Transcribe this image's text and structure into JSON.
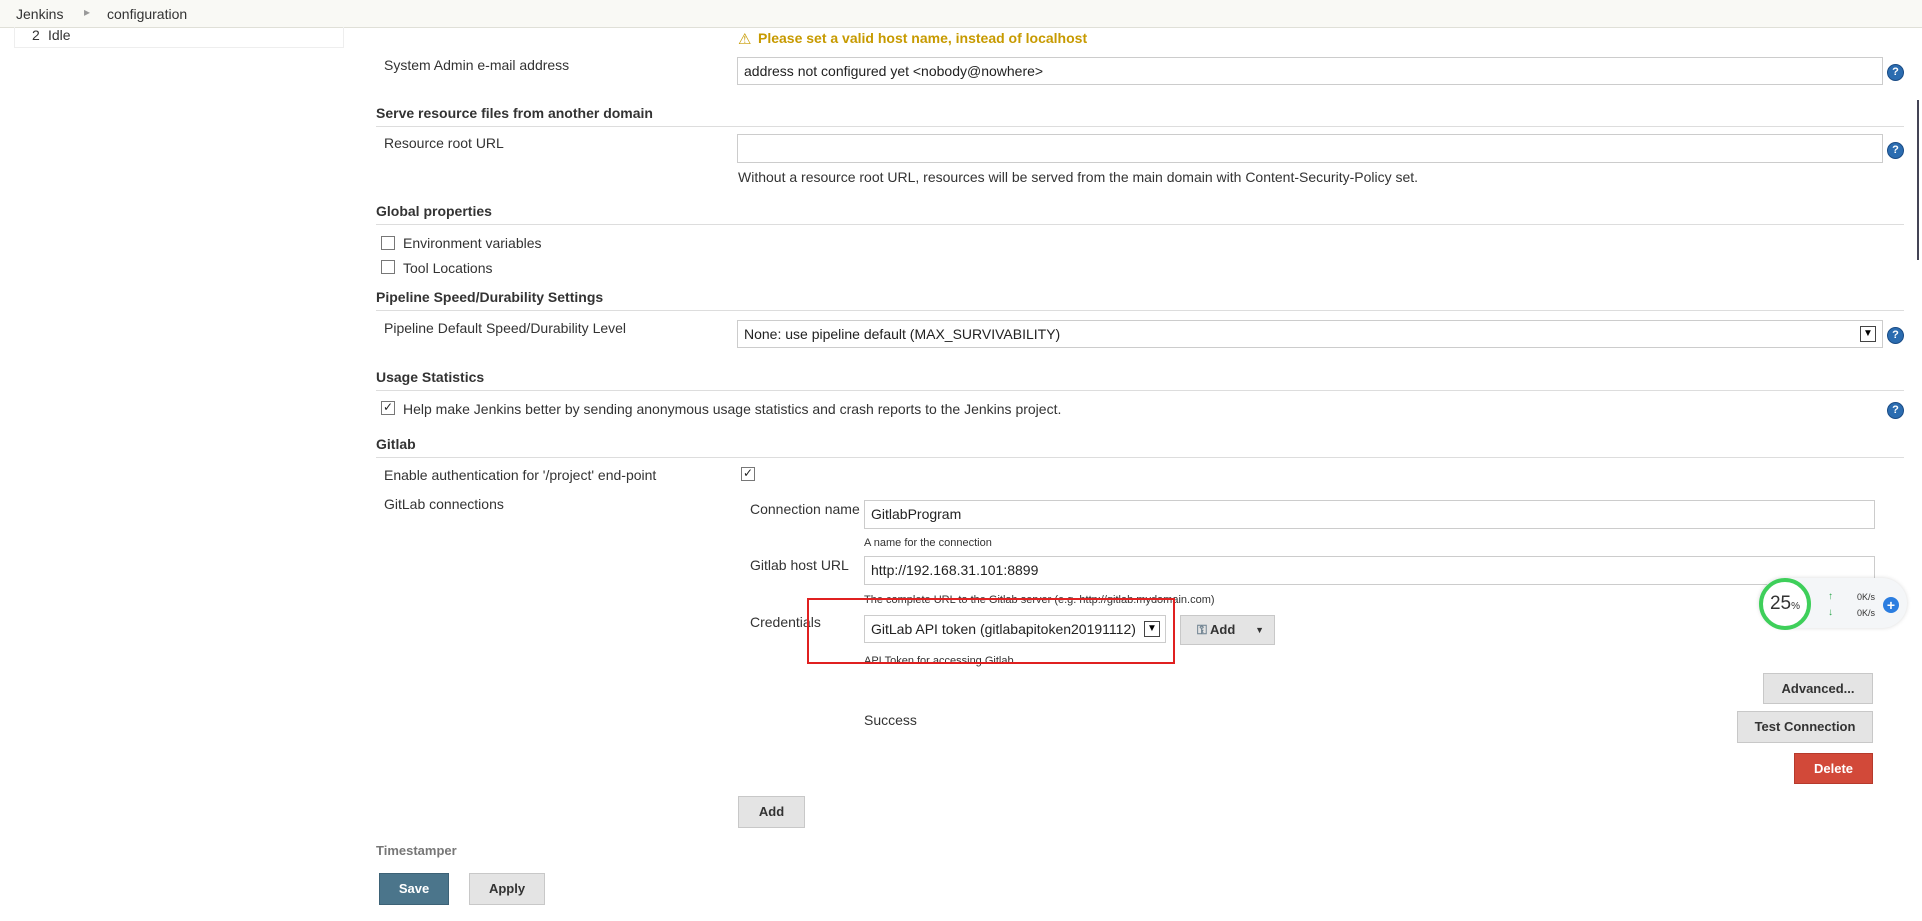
{
  "breadcrumb": {
    "items": [
      "Jenkins",
      "configuration"
    ],
    "separator": "▸"
  },
  "executor": {
    "number": "2",
    "status": "Idle"
  },
  "warning": {
    "text": "Please set a valid host name, instead of localhost",
    "color": "#c79a00"
  },
  "admin_email": {
    "label": "System Admin e-mail address",
    "value": "address not configured yet <nobody@nowhere>"
  },
  "resource_section": {
    "heading": "Serve resource files from another domain",
    "label": "Resource root URL",
    "value": "",
    "hint": "Without a resource root URL, resources will be served from the main domain with Content-Security-Policy set."
  },
  "global_properties": {
    "heading": "Global properties",
    "env_vars_label": "Environment variables",
    "tool_locations_label": "Tool Locations"
  },
  "pipeline_speed": {
    "heading": "Pipeline Speed/Durability Settings",
    "label": "Pipeline Default Speed/Durability Level",
    "selected": "None: use pipeline default (MAX_SURVIVABILITY)"
  },
  "usage_stats": {
    "heading": "Usage Statistics",
    "checkbox_label": "Help make Jenkins better by sending anonymous usage statistics and crash reports to the Jenkins project.",
    "checked": true
  },
  "gitlab": {
    "heading": "Gitlab",
    "auth_label": "Enable authentication for '/project' end-point",
    "auth_checked": true,
    "connections_label": "GitLab connections",
    "connection_name_label": "Connection name",
    "connection_name_value": "GitlabProgram",
    "connection_name_hint": "A name for the connection",
    "host_url_label": "Gitlab host URL",
    "host_url_value": "http://192.168.31.101:8899",
    "host_url_hint": "The complete URL to the Gitlab server (e.g. http://gitlab.mydomain.com)",
    "credentials_label": "Credentials",
    "credentials_selected": "GitLab API token (gitlabapitoken20191112)",
    "credentials_hint": "API Token for accessing Gitlab",
    "add_cred_label": "Add",
    "advanced_label": "Advanced...",
    "status_text": "Success",
    "test_connection_label": "Test Connection",
    "delete_label": "Delete",
    "add_connection_label": "Add"
  },
  "timestamper": {
    "heading": "Timestamper"
  },
  "footer": {
    "save_label": "Save",
    "apply_label": "Apply"
  },
  "network_widget": {
    "cpu_percent": "25",
    "percent_sign": "%",
    "up_speed": "0K/s",
    "down_speed": "0K/s",
    "up_arrow": "↑",
    "down_arrow": "↓"
  },
  "colors": {
    "save_button": "#4b758b",
    "delete_button": "#d24939",
    "highlight_box": "#e02020",
    "help_icon": "#2b6cb0",
    "widget_ring": "#3ecf5a"
  }
}
